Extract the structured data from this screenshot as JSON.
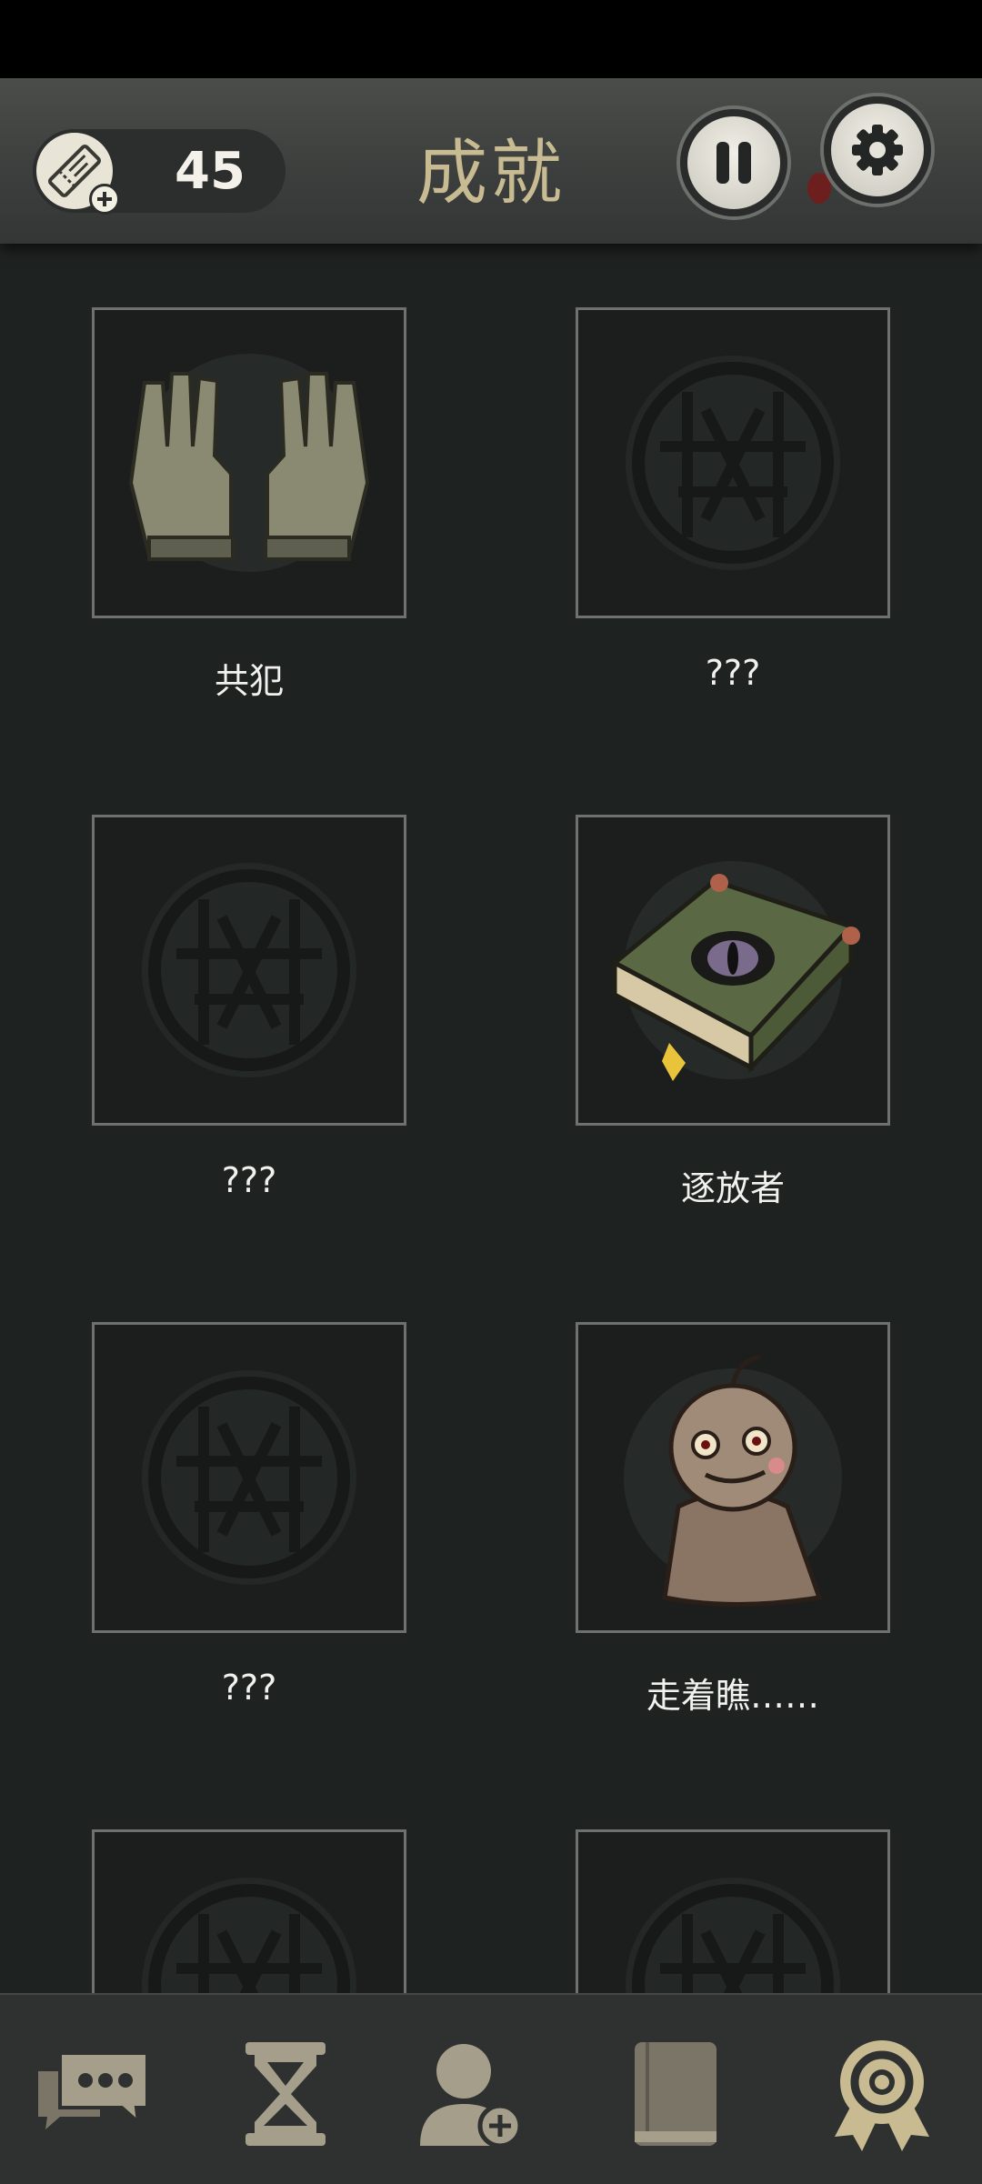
{
  "header": {
    "title": "成就",
    "ticket_count": "45",
    "ticket_icon": "ticket-icon",
    "pause_icon": "pause-icon",
    "settings_icon": "gear-icon"
  },
  "achievements": [
    {
      "label": "共犯",
      "icon": "gloves-icon",
      "unlocked": true
    },
    {
      "label": "???",
      "icon": "locked-seal-icon",
      "unlocked": false
    },
    {
      "label": "???",
      "icon": "locked-seal-icon",
      "unlocked": false
    },
    {
      "label": "逐放者",
      "icon": "eye-book-icon",
      "unlocked": true
    },
    {
      "label": "???",
      "icon": "locked-seal-icon",
      "unlocked": false
    },
    {
      "label": "走着瞧……",
      "icon": "doll-icon",
      "unlocked": true
    },
    {
      "label": "",
      "icon": "locked-seal-icon",
      "unlocked": false
    },
    {
      "label": "",
      "icon": "locked-seal-icon",
      "unlocked": false
    }
  ],
  "bottom_nav": [
    {
      "icon": "chat-icon",
      "active": false
    },
    {
      "icon": "hourglass-icon",
      "active": false
    },
    {
      "icon": "add-friend-icon",
      "active": false
    },
    {
      "icon": "book-icon",
      "active": false
    },
    {
      "icon": "medal-icon",
      "active": true
    }
  ],
  "colors": {
    "accent": "#c8bb92",
    "background": "#1e2221",
    "header": "#3b3e3c"
  }
}
